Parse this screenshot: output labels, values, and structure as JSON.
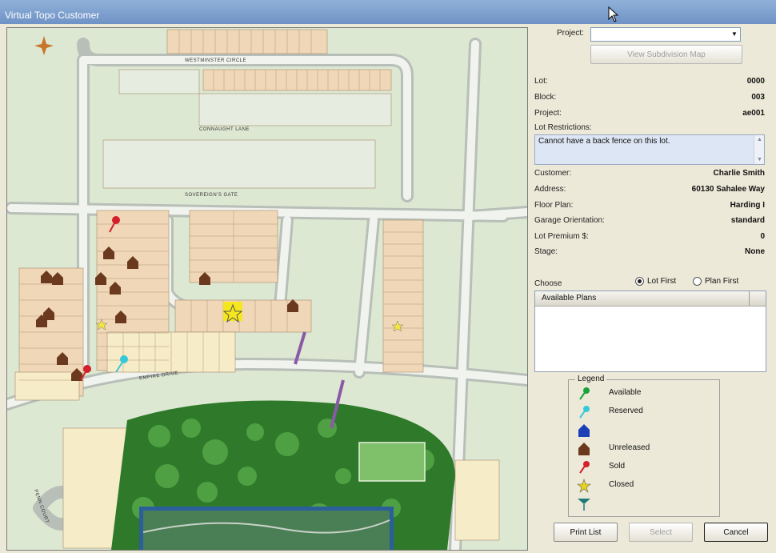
{
  "window": {
    "title": "Virtual Topo Customer"
  },
  "map": {
    "street_labels": [
      "WESTMINSTER CIRCLE",
      "CONNAUGHT LANE",
      "SOVEREIGN'S GATE",
      "EMPIRE DRIVE",
      "PENN COURT"
    ]
  },
  "panel": {
    "project_label": "Project:",
    "project_value": "",
    "view_map_button": "View Subdivision Map",
    "fields": [
      {
        "label": "Lot:",
        "value": "0000"
      },
      {
        "label": "Block:",
        "value": "003"
      },
      {
        "label": "Project:",
        "value": "ae001"
      }
    ],
    "restrictions_label": "Lot Restrictions:",
    "restrictions_text": "Cannot have a back fence on this lot.",
    "customer_fields": [
      {
        "label": "Customer:",
        "value": "Charlie Smith"
      },
      {
        "label": "Address:",
        "value": "60130 Sahalee Way"
      },
      {
        "label": "Floor Plan:",
        "value": "Harding I"
      },
      {
        "label": "Garage Orientation:",
        "value": "standard"
      },
      {
        "label": "Lot Premium $:",
        "value": "0"
      },
      {
        "label": "Stage:",
        "value": "None"
      }
    ],
    "choose_label": "Choose",
    "radio_lot_first": "Lot First",
    "radio_plan_first": "Plan First",
    "plans_header": "Available Plans",
    "legend_title": "Legend",
    "legend_items": [
      {
        "label": "Available",
        "icon": "green-pin-icon",
        "color": "#1aa33c"
      },
      {
        "label": "Reserved",
        "icon": "cyan-pin-icon",
        "color": "#36c8d8"
      },
      {
        "label": "",
        "icon": "blue-house-icon",
        "color": "#1c3fb8"
      },
      {
        "label": "Unreleased",
        "icon": "brown-house-icon",
        "color": "#6b3a1e"
      },
      {
        "label": "Sold",
        "icon": "red-pin-icon",
        "color": "#d4202a"
      },
      {
        "label": "Closed",
        "icon": "star-icon",
        "color": "#e8d21a"
      },
      {
        "label": "",
        "icon": "flag-icon",
        "color": "#1e7a7a"
      }
    ],
    "print_button": "Print List",
    "select_button": "Select",
    "cancel_button": "Cancel"
  }
}
